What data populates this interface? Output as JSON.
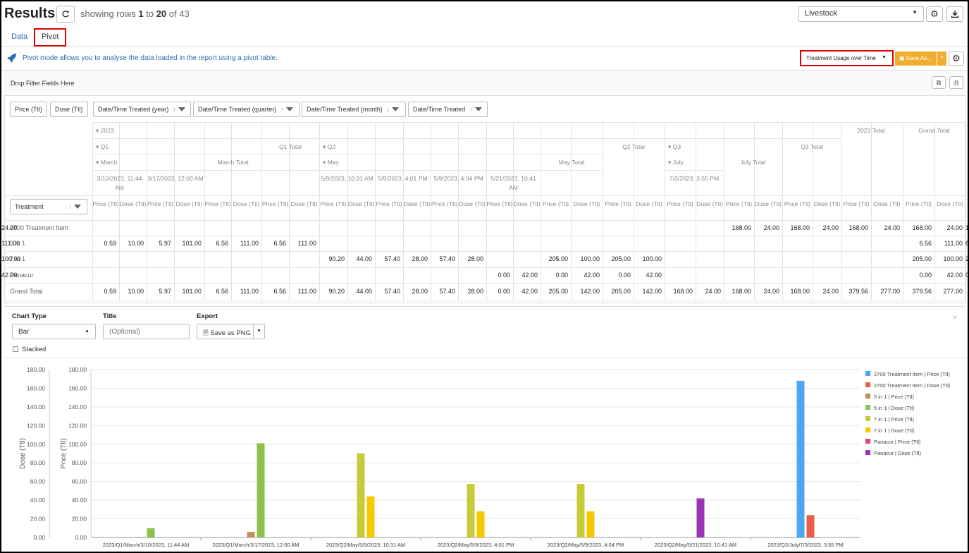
{
  "header": {
    "title": "Results",
    "rows_prefix": "showing rows ",
    "rows_from": "1",
    "rows_to_word": " to ",
    "rows_to": "20",
    "rows_of": " of 43",
    "dataset": "Livestock"
  },
  "tabs": {
    "data": "Data",
    "pivot": "Pivot"
  },
  "info": {
    "text": "Pivot mode allows you to analyse the data loaded in the report using a pivot table.",
    "config": "Treatment Usage over Time",
    "save_as": "Save As..."
  },
  "pivot": {
    "filter_text": "Drop Filter Fields Here",
    "value_fields": [
      "Price (Ttl)",
      "Dose (Ttl)"
    ],
    "column_fields": [
      "Date/Time Treated (year)",
      "Date/Time Treated (quarter)",
      "Date/Time Treated (month)",
      "Date/Time Treated"
    ],
    "row_field": "Treatment",
    "year": "2023",
    "year_total": "2023 Total",
    "grand_total": "Grand Total",
    "quarters": [
      "Q1",
      "Q2",
      "Q3"
    ],
    "quarter_totals": [
      "Q1 Total",
      "Q2 Total",
      "Q3 Total"
    ],
    "months": [
      "March",
      "May",
      "July"
    ],
    "month_totals": [
      "March Total",
      "May Total",
      "July Total"
    ],
    "dates": [
      "3/10/2023, 11:44 AM",
      "3/17/2023, 12:00 AM",
      "5/9/2023, 10:31 AM",
      "5/9/2023, 4:01 PM",
      "5/9/2023, 4:04 PM",
      "5/21/2023, 10:41 AM",
      "7/3/2023, 3:55 PM"
    ],
    "measure_labels": [
      "Price (Ttl)",
      "Dose (Ttl)"
    ],
    "rows": [
      {
        "label": "2700 Treatment Item",
        "values": [
          "",
          "",
          "",
          "",
          "",
          "",
          "",
          "",
          "",
          "",
          "",
          "",
          "",
          "",
          "",
          "",
          "",
          "",
          "",
          "",
          "",
          "",
          "168.00",
          "24.00",
          "168.00",
          "24.00",
          "168.00",
          "24.00",
          "168.00",
          "24.00",
          "168.00",
          "24.00"
        ]
      },
      {
        "label": "5 in 1",
        "values": [
          "0.59",
          "10.00",
          "5.97",
          "101.00",
          "6.56",
          "111.00",
          "6.56",
          "111.00",
          "",
          "",
          "",
          "",
          "",
          "",
          "",
          "",
          "",
          "",
          "",
          "",
          "",
          "",
          "",
          "",
          "",
          "",
          "",
          "",
          "6.56",
          "111.00",
          "6.56",
          "111.00"
        ]
      },
      {
        "label": "7 in 1",
        "values": [
          "",
          "",
          "",
          "",
          "",
          "",
          "",
          "",
          "90.20",
          "44.00",
          "57.40",
          "28.00",
          "57.40",
          "28.00",
          "",
          "",
          "205.00",
          "100.00",
          "205.00",
          "100.00",
          "",
          "",
          "",
          "",
          "",
          "",
          "",
          "",
          "205.00",
          "100.00",
          "205.00",
          "100.00"
        ]
      },
      {
        "label": "Panacur",
        "values": [
          "",
          "",
          "",
          "",
          "",
          "",
          "",
          "",
          "",
          "",
          "",
          "",
          "",
          "",
          "0.00",
          "42.00",
          "0.00",
          "42.00",
          "0.00",
          "42.00",
          "",
          "",
          "",
          "",
          "",
          "",
          "",
          "",
          "0.00",
          "42.00",
          "0.00",
          "42.00"
        ]
      },
      {
        "label": "Grand Total",
        "values": [
          "0.59",
          "10.00",
          "5.97",
          "101.00",
          "6.56",
          "111.00",
          "6.56",
          "111.00",
          "90.20",
          "44.00",
          "57.40",
          "28.00",
          "57.40",
          "28.00",
          "0.00",
          "42.00",
          "205.00",
          "142.00",
          "205.00",
          "142.00",
          "168.00",
          "24.00",
          "168.00",
          "24.00",
          "168.00",
          "24.00",
          "379.56",
          "277.00",
          "379.56",
          "277.00"
        ]
      }
    ]
  },
  "chart_controls": {
    "chart_type_label": "Chart Type",
    "chart_type": "Bar",
    "title_label": "Title",
    "title_placeholder": "(Optional)",
    "export_label": "Export",
    "save_png": "Save as PNG",
    "stacked": "Stacked",
    "close": "×"
  },
  "chart_data": {
    "type": "bar",
    "title": "",
    "ylabel_left": "Dose (Ttl)",
    "ylabel_right": "Price (Ttl)",
    "ylim": [
      0,
      180
    ],
    "yticks": [
      "0.00",
      "20.00",
      "40.00",
      "60.00",
      "80.00",
      "100.00",
      "120.00",
      "140.00",
      "160.00",
      "180.00"
    ],
    "categories": [
      "2023/Q1/March/3/10/2023, 11:44 AM",
      "2023/Q1/March/3/17/2023, 12:00 AM",
      "2023/Q2/May/5/9/2023, 10:31 AM",
      "2023/Q2/May/5/9/2023, 4:01 PM",
      "2023/Q2/May/5/9/2023, 4:04 PM",
      "2023/Q2/May/5/21/2023, 10:41 AM",
      "2023/Q3/July/7/3/2023, 3:55 PM"
    ],
    "legend_position": "right",
    "series": [
      {
        "name": "2700 Treatment Item | Price (Ttl)",
        "color": "#4da6f2",
        "values": [
          null,
          null,
          null,
          null,
          null,
          null,
          168
        ]
      },
      {
        "name": "2700 Treatment Item | Dose (Ttl)",
        "color": "#e8604c",
        "values": [
          null,
          null,
          null,
          null,
          null,
          null,
          24
        ]
      },
      {
        "name": "5 in 1 | Price (Ttl)",
        "color": "#c0905a",
        "values": [
          0.59,
          5.97,
          null,
          null,
          null,
          null,
          null
        ]
      },
      {
        "name": "5 in 1 | Dose (Ttl)",
        "color": "#8bc34a",
        "values": [
          10,
          101,
          null,
          null,
          null,
          null,
          null
        ]
      },
      {
        "name": "7 in 1 | Price (Ttl)",
        "color": "#c5cc38",
        "values": [
          null,
          null,
          90.2,
          57.4,
          57.4,
          null,
          null
        ]
      },
      {
        "name": "7 in 1 | Dose (Ttl)",
        "color": "#f5c800",
        "values": [
          null,
          null,
          44,
          28,
          28,
          null,
          null
        ]
      },
      {
        "name": "Panacur | Price (Ttl)",
        "color": "#e0457b",
        "values": [
          null,
          null,
          null,
          null,
          null,
          0,
          null
        ]
      },
      {
        "name": "Panacur | Dose (Ttl)",
        "color": "#9c35b5",
        "values": [
          null,
          null,
          null,
          null,
          null,
          42,
          null
        ]
      }
    ]
  }
}
